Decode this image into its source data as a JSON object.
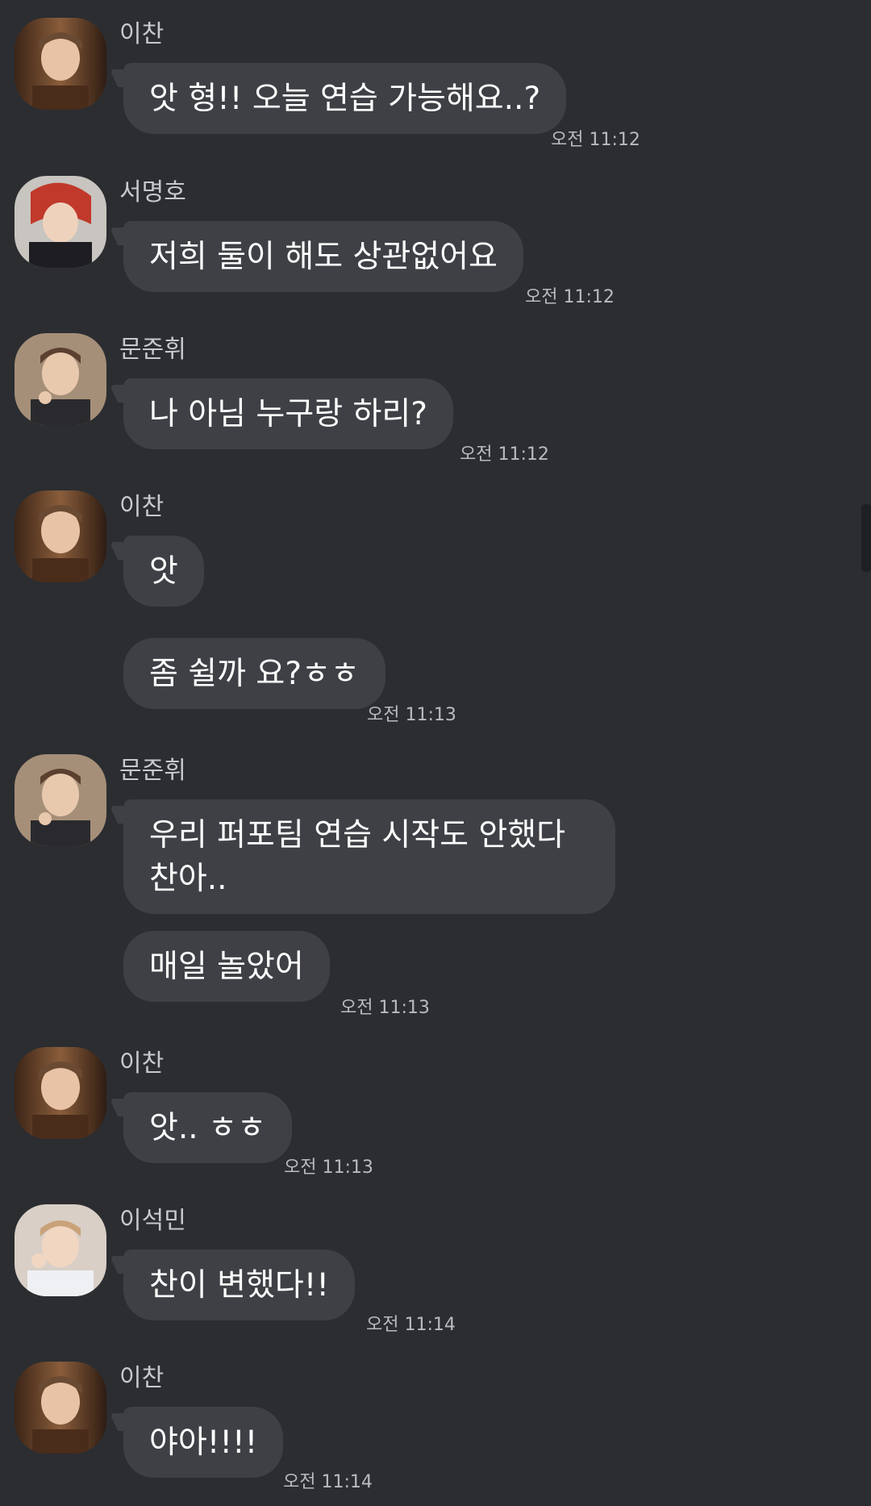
{
  "messages": [
    {
      "sender": "이찬",
      "avatar": "lee-chan-avatar",
      "bubbles": [
        "앗 형!! 오늘 연습 가능해요..?"
      ],
      "time": "오전 11:12"
    },
    {
      "sender": "서명호",
      "avatar": "seo-myungho-avatar",
      "bubbles": [
        "저희 둘이 해도 상관없어요"
      ],
      "time": "오전 11:12"
    },
    {
      "sender": "문준휘",
      "avatar": "moon-junhui-avatar",
      "bubbles": [
        "나 아님 누구랑 하리?"
      ],
      "time": "오전 11:12"
    },
    {
      "sender": "이찬",
      "avatar": "lee-chan-avatar",
      "bubbles": [
        "앗",
        "좀 쉴까 요?ㅎㅎ"
      ],
      "time": "오전 11:13"
    },
    {
      "sender": "문준휘",
      "avatar": "moon-junhui-avatar",
      "bubbles": [
        "우리 퍼포팀 연습 시작도 안했다 찬아..",
        "매일 놀았어"
      ],
      "time": "오전 11:13"
    },
    {
      "sender": "이찬",
      "avatar": "lee-chan-avatar",
      "bubbles": [
        "앗.. ㅎㅎ"
      ],
      "time": "오전 11:13"
    },
    {
      "sender": "이석민",
      "avatar": "lee-seokmin-avatar",
      "bubbles": [
        "찬이 변했다!!"
      ],
      "time": "오전 11:14"
    },
    {
      "sender": "이찬",
      "avatar": "lee-chan-avatar",
      "bubbles": [
        "야아!!!!"
      ],
      "time": "오전 11:14"
    }
  ],
  "colors": {
    "background": "#2b2d31",
    "bubble": "#3e4045",
    "sender_text": "#c7c9cd",
    "timestamp_text": "#b9bbbe"
  }
}
